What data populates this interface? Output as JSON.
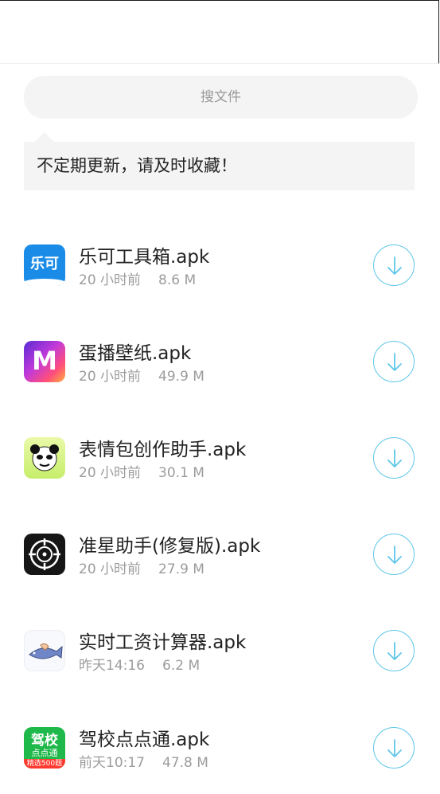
{
  "search": {
    "placeholder": "搜文件"
  },
  "notice": {
    "text": "不定期更新，请及时收藏！"
  },
  "files": [
    {
      "name": "乐可工具箱.apk",
      "time": "20 小时前",
      "size": "8.6 M",
      "icon": "leke-app-icon",
      "icon_text": "乐可"
    },
    {
      "name": "蛋播壁纸.apk",
      "time": "20 小时前",
      "size": "49.9 M",
      "icon": "danbo-app-icon",
      "icon_text": "M"
    },
    {
      "name": "表情包创作助手.apk",
      "time": "20 小时前",
      "size": "30.1 M",
      "icon": "panda-face-app-icon"
    },
    {
      "name": "准星助手(修复版).apk",
      "time": "20 小时前",
      "size": "27.9 M",
      "icon": "crosshair-app-icon"
    },
    {
      "name": "实时工资计算器.apk",
      "time": "昨天14:16",
      "size": "6.2 M",
      "icon": "fish-hand-app-icon"
    },
    {
      "name": "驾校点点通.apk",
      "time": "前天10:17",
      "size": "47.8 M",
      "icon": "jiaxiao-app-icon",
      "icon_text": "驾校",
      "icon_subtext": "点点通",
      "icon_badge": "精选500题"
    }
  ],
  "colors": {
    "accent": "#5ec6e8",
    "muted": "#9c9c9c",
    "panel": "#f4f4f4"
  }
}
